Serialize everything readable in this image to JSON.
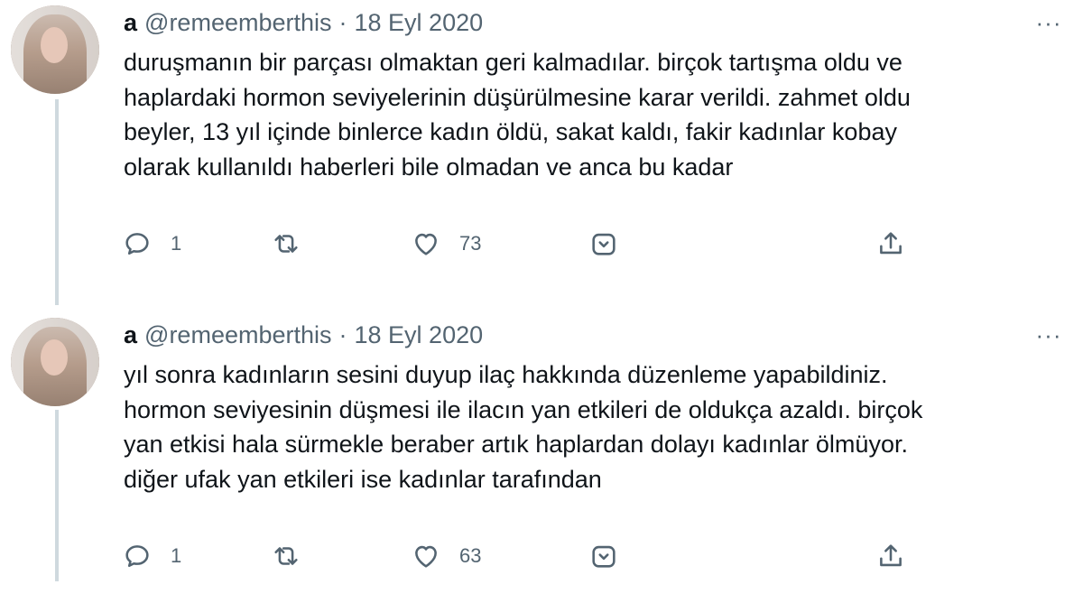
{
  "tweets": [
    {
      "display_name": "a",
      "handle": "@remeemberthis",
      "separator": "·",
      "date": "18 Eyl 2020",
      "more": "···",
      "text": "duruşmanın bir parçası olmaktan geri kalmadılar. birçok tartışma oldu ve\nhaplardaki hormon seviyelerinin düşürülmesine karar verildi. zahmet oldu\nbeyler, 13 yıl içinde binlerce kadın öldü, sakat kaldı, fakir kadınlar kobay\nolarak kullanıldı haberleri bile olmadan ve anca bu kadar",
      "replies": "1",
      "retweets": "",
      "likes": "73"
    },
    {
      "display_name": "a",
      "handle": "@remeemberthis",
      "separator": "·",
      "date": "18 Eyl 2020",
      "more": "···",
      "text": "yıl sonra kadınların sesini duyup ilaç hakkında düzenleme yapabildiniz.\nhormon seviyesinin düşmesi ile ilacın yan etkileri de oldukça azaldı. birçok\nyan etkisi hala sürmekle beraber artık haplardan dolayı kadınlar ölmüyor.\ndiğer ufak yan etkileri ise kadınlar tarafından",
      "replies": "1",
      "retweets": "",
      "likes": "63"
    }
  ],
  "icons": {
    "reply": "reply-icon",
    "retweet": "retweet-icon",
    "like": "heart-icon",
    "tip": "tip-jar-icon",
    "share": "share-icon"
  },
  "colors": {
    "text": "#0f1419",
    "secondary": "#536471",
    "thread_line": "#cfd9de"
  }
}
